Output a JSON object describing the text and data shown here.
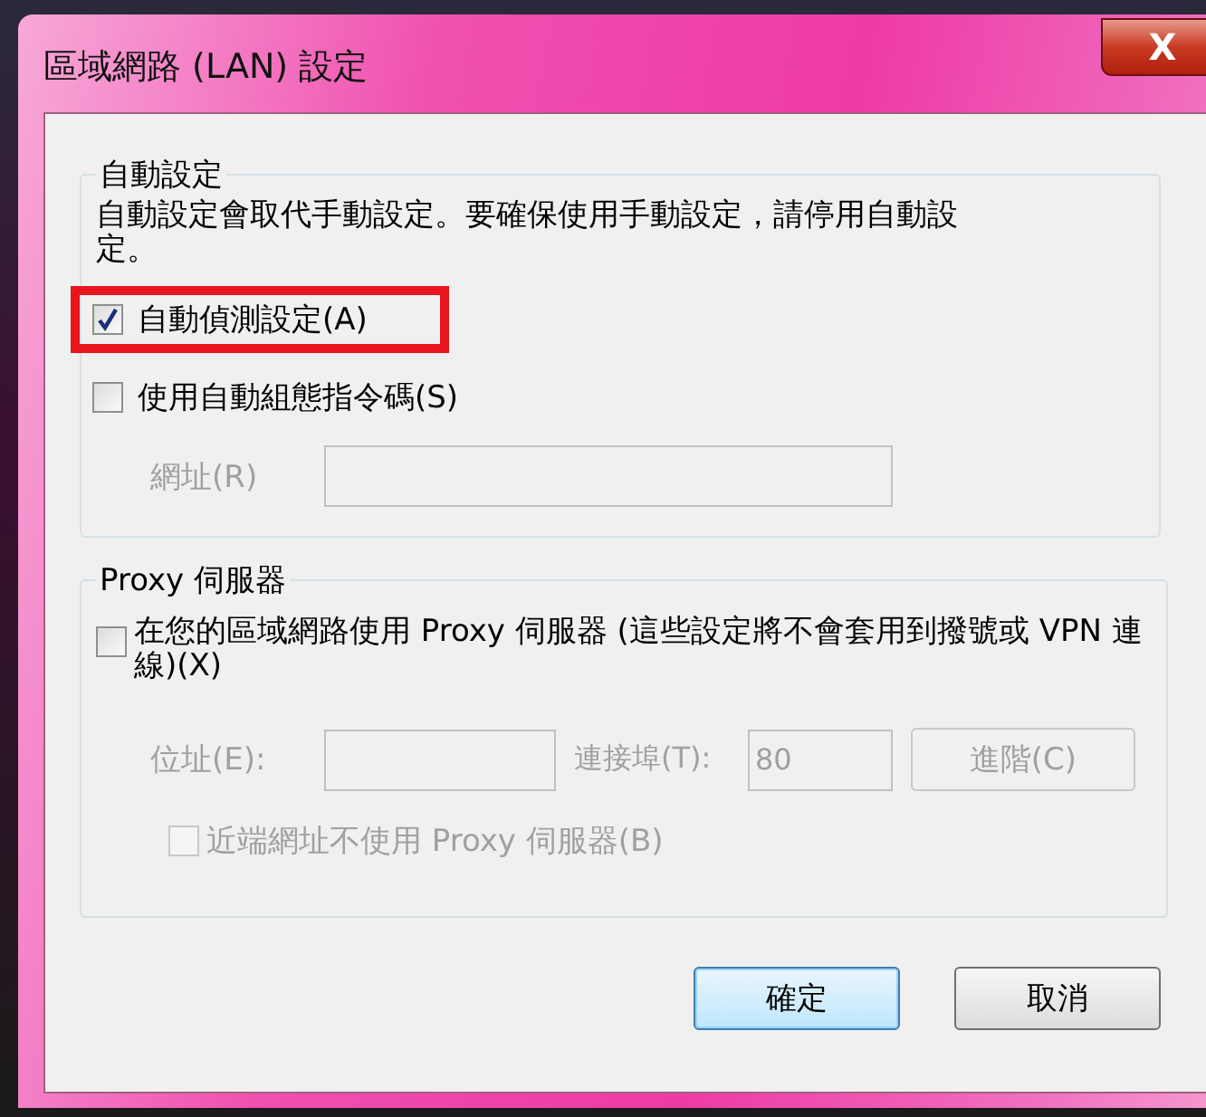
{
  "window": {
    "title": "區域網路 (LAN) 設定",
    "close_label": "X"
  },
  "auto_config": {
    "legend": "自動設定",
    "description": "自動設定會取代手動設定。要確保使用手動設定，請停用自動設定。",
    "checkboxes": [
      {
        "label": "自動偵測設定(A)",
        "checked": true,
        "disabled": false,
        "highlighted": true
      },
      {
        "label": "使用自動組態指令碼(S)",
        "checked": false,
        "disabled": false,
        "highlighted": false
      }
    ],
    "address": {
      "label": "網址(R)",
      "disabled": true
    }
  },
  "proxy": {
    "legend": "Proxy 伺服器",
    "checkbox": {
      "label": "在您的區域網路使用 Proxy 伺服器 (這些設定將不會套用到撥號或 VPN 連線)(X)",
      "checked": false,
      "disabled": false
    },
    "address": {
      "label": "位址(E):",
      "disabled": true
    },
    "port": {
      "label": "連接埠(T):",
      "value": "80",
      "disabled": true
    },
    "advanced": {
      "label": "進階(C)",
      "disabled": true
    },
    "bypass": {
      "label": "近端網址不使用 Proxy 伺服器(B)",
      "checked": false,
      "disabled": true
    }
  },
  "buttons": [
    {
      "label": "確定",
      "default": true
    },
    {
      "label": "取消",
      "default": false
    }
  ]
}
